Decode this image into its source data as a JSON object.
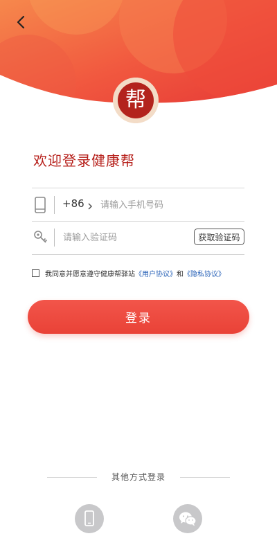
{
  "header": {
    "back_icon": "chevron-left-icon",
    "logo_char": "帮"
  },
  "welcome": "欢迎登录健康帮",
  "phone": {
    "icon": "phone-icon",
    "country_code": "+86",
    "arrow_icon": "chevron-right-icon",
    "value": "",
    "placeholder": "请输入手机号码"
  },
  "code": {
    "icon": "key-icon",
    "value": "",
    "placeholder": "请输入验证码",
    "button_label": "获取验证码"
  },
  "agreement": {
    "checked": false,
    "prefix": "我同意并愿意遵守健康帮驿站",
    "user_link": "《用户协议》",
    "and": "和",
    "privacy_link": "《隐私协议》"
  },
  "login_button": "登录",
  "other_login": {
    "title": "其他方式登录",
    "options": [
      {
        "name": "phone-login",
        "icon": "mobile-icon"
      },
      {
        "name": "wechat-login",
        "icon": "wechat-icon"
      }
    ]
  },
  "colors": {
    "brand_red": "#b61f1a",
    "button_red": "#ee4a3f",
    "link_blue": "#2a63b8",
    "logo_cream": "#f3dcc7"
  }
}
